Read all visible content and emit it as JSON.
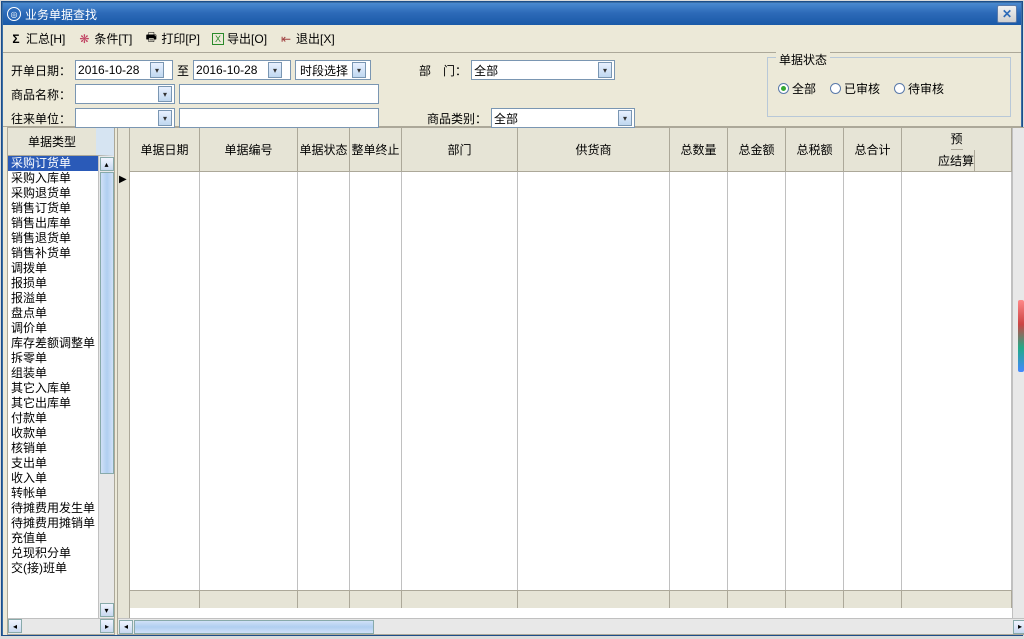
{
  "window": {
    "title": "业务单据查找",
    "close": "✕"
  },
  "toolbar": {
    "summary": "汇总[H]",
    "condition": "条件[T]",
    "print": "打印[P]",
    "export": "导出[O]",
    "exit": "退出[X]"
  },
  "filters": {
    "date_label": "开单日期：",
    "date_from": "2016-10-28",
    "to": "至",
    "date_to": "2016-10-28",
    "time_select": "时段选择",
    "dept_label": "部　门：",
    "dept_value": "全部",
    "name_label": "商品名称：",
    "name_value": "",
    "unit_label": "往来单位：",
    "unit_value": "",
    "cat_label": "商品类别：",
    "cat_value": "全部"
  },
  "status_group": {
    "legend": "单据状态",
    "all": "全部",
    "approved": "已审核",
    "pending": "待审核"
  },
  "sidebar": {
    "header": "单据类型",
    "items": [
      "采购订货单",
      "采购入库单",
      "采购退货单",
      "销售订货单",
      "销售出库单",
      "销售退货单",
      "销售补货单",
      "调拨单",
      "报损单",
      "报溢单",
      "盘点单",
      "调价单",
      "库存差额调整单",
      "拆零单",
      "组装单",
      "其它入库单",
      "其它出库单",
      "付款单",
      "收款单",
      "核销单",
      "支出单",
      "收入单",
      "转帐单",
      "待摊费用发生单",
      "待摊费用摊销单",
      "充值单",
      "兑现积分单",
      "交(接)班单"
    ]
  },
  "grid": {
    "columns": [
      "单据日期",
      "单据编号",
      "单据状态",
      "整单终止",
      "部门",
      "供货商",
      "总数量",
      "总金额",
      "总税额",
      "总合计"
    ],
    "group_col": {
      "top": "预",
      "sub": [
        "应结算"
      ]
    }
  }
}
